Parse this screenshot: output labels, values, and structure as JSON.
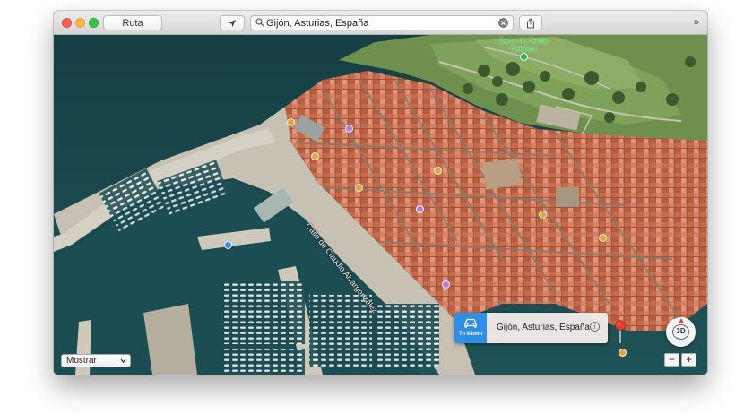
{
  "toolbar": {
    "route_label": "Ruta",
    "search_value": "Gijón, Asturias, España",
    "more_label": "»"
  },
  "map": {
    "street_label": "Calle de Claudio Alvargonzález",
    "park_label": "Cerro de Santa Catalina"
  },
  "callout": {
    "eta": "7h 43min",
    "place": "Gijón, Asturias, España",
    "info_icon": "i"
  },
  "controls": {
    "view_mode": "3D",
    "zoom_out": "−",
    "zoom_in": "+",
    "show_select": "Mostrar"
  },
  "colors": {
    "route_accent": "#2f8fe6",
    "pin": "#e53b2c"
  }
}
